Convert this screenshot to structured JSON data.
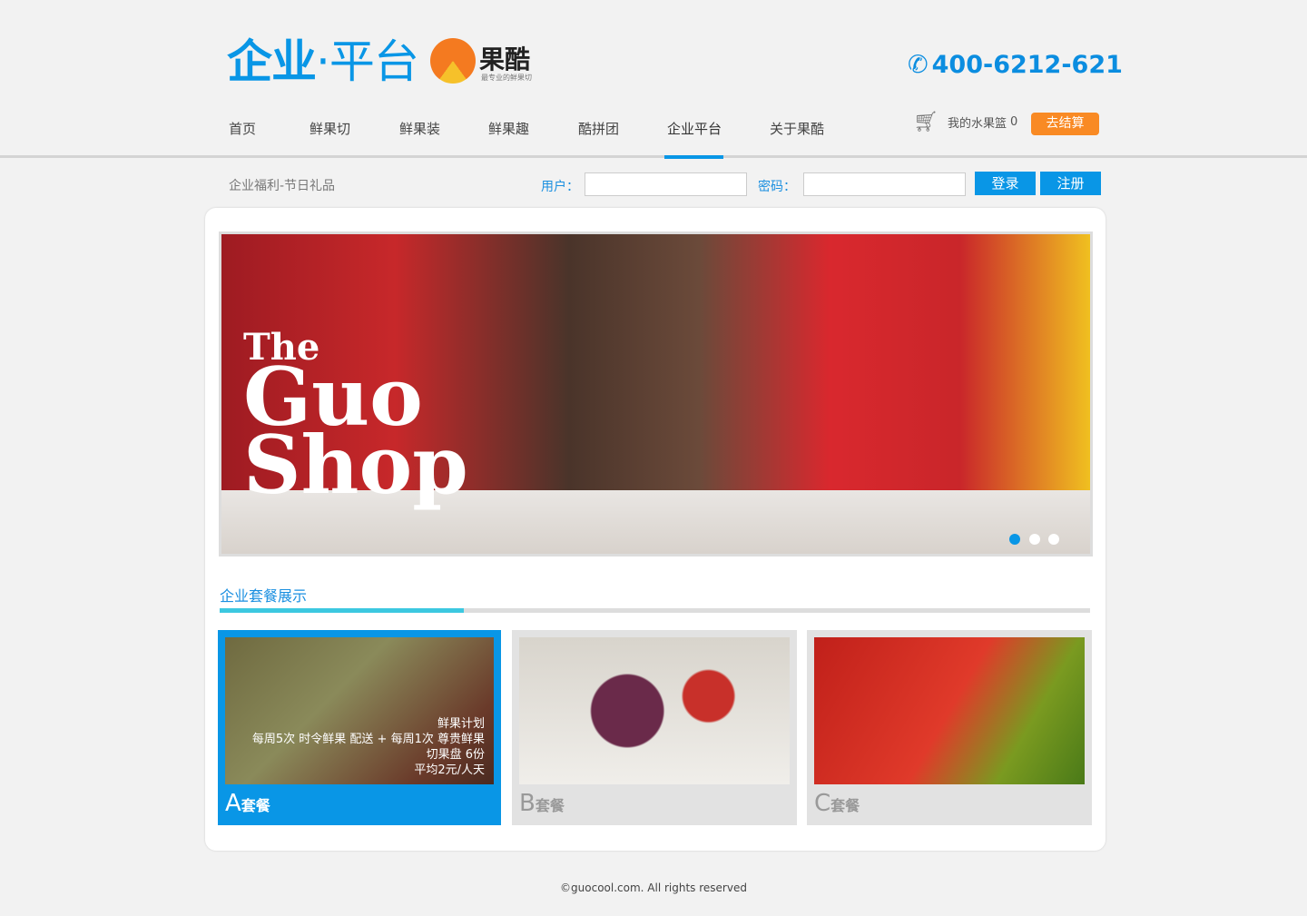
{
  "header": {
    "title_bold": "企业",
    "title_dot": "·",
    "title_light": "平台",
    "brand_name": "果酷",
    "brand_tagline": "最专业的鲜果切",
    "phone": "400-6212-621"
  },
  "nav": {
    "items": [
      "首页",
      "鲜果切",
      "鲜果装",
      "鲜果趣",
      "酷拼团",
      "企业平台",
      "关于果酷"
    ],
    "active": "企业平台"
  },
  "cart": {
    "label": "我的水果篮",
    "count": "0",
    "checkout": "去结算"
  },
  "login": {
    "breadcrumb": "企业福利-节日礼品",
    "user_label": "用户：",
    "user_value": "",
    "password_label": "密码：",
    "password_value": "",
    "login": "登录",
    "register": "注册"
  },
  "banner": {
    "line1": "The",
    "line2": "Guo",
    "line3": "Shop",
    "slides": 3,
    "active_slide": 1
  },
  "section": {
    "title": "企业套餐展示",
    "progress": 0.28
  },
  "packages": [
    {
      "letter": "A",
      "suffix": "套餐",
      "desc": [
        "鲜果计划",
        "每周5次 时令鲜果 配送 + 每周1次 尊贵鲜果",
        "切果盘 6份",
        "平均2元/人天"
      ]
    },
    {
      "letter": "B",
      "suffix": "套餐"
    },
    {
      "letter": "C",
      "suffix": "套餐"
    }
  ],
  "footer": "©guocool.com. All rights reserved",
  "colors": {
    "accent": "#0996e6",
    "checkout": "#f98a24",
    "progress": "#3cc8e0"
  }
}
